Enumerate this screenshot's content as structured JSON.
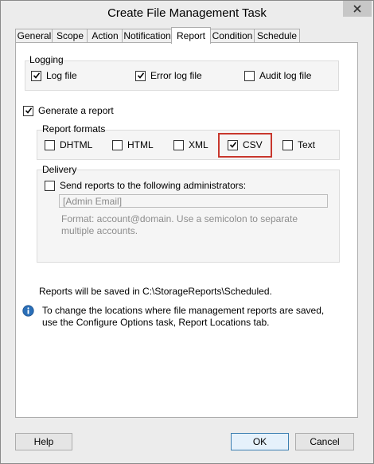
{
  "window": {
    "title": "Create File Management Task"
  },
  "tabs": [
    "General",
    "Scope",
    "Action",
    "Notification",
    "Report",
    "Condition",
    "Schedule"
  ],
  "active_tab": "Report",
  "logging": {
    "label": "Logging",
    "log_file": {
      "label": "Log file",
      "checked": true
    },
    "error_log_file": {
      "label": "Error log file",
      "checked": true
    },
    "audit_log_file": {
      "label": "Audit log file",
      "checked": false
    }
  },
  "generate_report": {
    "label": "Generate a report",
    "checked": true
  },
  "report_formats": {
    "label": "Report formats",
    "dhtml": {
      "label": "DHTML",
      "checked": false
    },
    "html": {
      "label": "HTML",
      "checked": false
    },
    "xml": {
      "label": "XML",
      "checked": false
    },
    "csv": {
      "label": "CSV",
      "checked": true
    },
    "text": {
      "label": "Text",
      "checked": false
    }
  },
  "delivery": {
    "label": "Delivery",
    "send_reports": {
      "label": "Send reports to the following administrators:",
      "checked": false
    },
    "email_field": {
      "value": "[Admin Email]"
    },
    "hint": "Format: account@domain. Use a semicolon to separate multiple accounts."
  },
  "saved_path_text": "Reports will be saved in C:\\StorageReports\\Scheduled.",
  "info_text": "To change the locations where file management reports are saved, use the Configure Options task, Report Locations tab.",
  "buttons": {
    "help": "Help",
    "ok": "OK",
    "cancel": "Cancel"
  },
  "colors": {
    "highlight": "#c8372d",
    "info_icon": "#2a6fb8"
  }
}
